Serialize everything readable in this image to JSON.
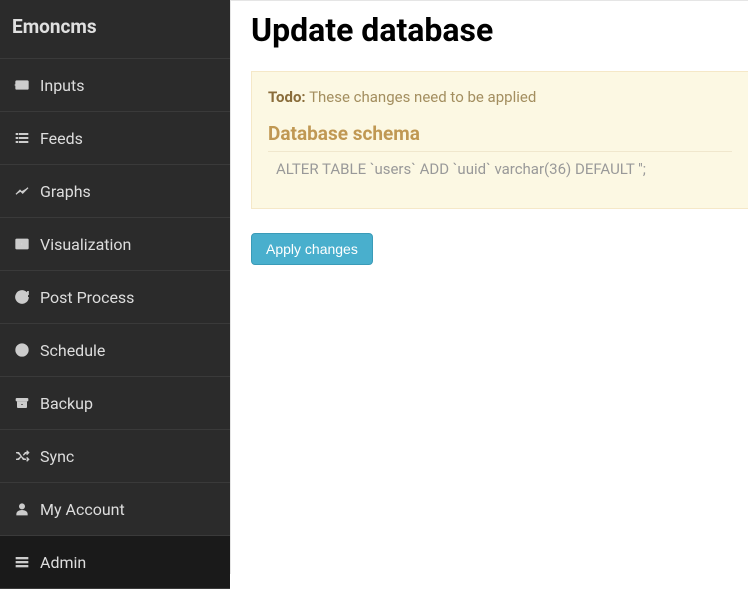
{
  "sidebar": {
    "brand": "Emoncms",
    "items": [
      {
        "label": "Inputs"
      },
      {
        "label": "Feeds"
      },
      {
        "label": "Graphs"
      },
      {
        "label": "Visualization"
      },
      {
        "label": "Post Process"
      },
      {
        "label": "Schedule"
      },
      {
        "label": "Backup"
      },
      {
        "label": "Sync"
      },
      {
        "label": "My Account"
      },
      {
        "label": "Admin"
      }
    ]
  },
  "main": {
    "page_title": "Update database",
    "alert": {
      "todo_label": "Todo:",
      "todo_message": "These changes need to be applied",
      "schema_heading": "Database schema",
      "sql": "ALTER TABLE `users` ADD `uuid` varchar(36) DEFAULT '';"
    },
    "apply_button": "Apply changes"
  }
}
